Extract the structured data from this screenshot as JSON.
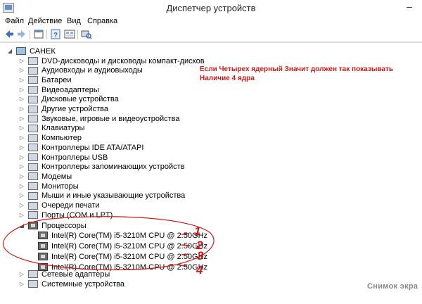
{
  "window": {
    "title": "Диспетчер устройств",
    "minimize": "–"
  },
  "menu": [
    "Файл",
    "Действие",
    "Вид",
    "Справка"
  ],
  "tree": {
    "root": "САНЕК",
    "categories": [
      {
        "label": "DVD-дисководы и дисководы компакт-дисков",
        "icon": "dvd-drive-icon"
      },
      {
        "label": "Аудиовходы и аудиовыходы",
        "icon": "audio-icon"
      },
      {
        "label": "Батареи",
        "icon": "battery-icon"
      },
      {
        "label": "Видеоадаптеры",
        "icon": "display-adapter-icon"
      },
      {
        "label": "Дисковые устройства",
        "icon": "disk-drive-icon"
      },
      {
        "label": "Другие устройства",
        "icon": "other-devices-icon"
      },
      {
        "label": "Звуковые, игровые и видеоустройства",
        "icon": "sound-icon"
      },
      {
        "label": "Клавиатуры",
        "icon": "keyboard-icon"
      },
      {
        "label": "Компьютер",
        "icon": "computer-icon"
      },
      {
        "label": "Контроллеры IDE ATA/ATAPI",
        "icon": "ide-controller-icon"
      },
      {
        "label": "Контроллеры USB",
        "icon": "usb-controller-icon"
      },
      {
        "label": "Контроллеры запоминающих устройств",
        "icon": "storage-controller-icon"
      },
      {
        "label": "Модемы",
        "icon": "modem-icon"
      },
      {
        "label": "Мониторы",
        "icon": "monitor-icon"
      },
      {
        "label": "Мыши и иные указывающие устройства",
        "icon": "mouse-icon"
      },
      {
        "label": "Очереди печати",
        "icon": "print-queue-icon"
      },
      {
        "label": "Порты (COM и LPT)",
        "icon": "ports-icon"
      }
    ],
    "processors": {
      "label": "Процессоры",
      "items": [
        "Intel(R) Core(TM) i5-3210M CPU @ 2.50GHz",
        "Intel(R) Core(TM) i5-3210M CPU @ 2.50GHz",
        "Intel(R) Core(TM) i5-3210M CPU @ 2.50GHz",
        "Intel(R) Core(TM) i5-3210M CPU @ 2.50GHz"
      ]
    },
    "after": [
      {
        "label": "Сетевые адаптеры",
        "icon": "network-adapter-icon"
      },
      {
        "label": "Системные устройства",
        "icon": "system-devices-icon"
      }
    ]
  },
  "annotation": {
    "line1": "Если Четырех ядерный Значит должен так показывать",
    "line2": "Наличие 4 ядра",
    "numbers": [
      "1",
      "2",
      "3",
      "4"
    ],
    "color": "#cc1a1a"
  },
  "watermark": "Снимок экра"
}
